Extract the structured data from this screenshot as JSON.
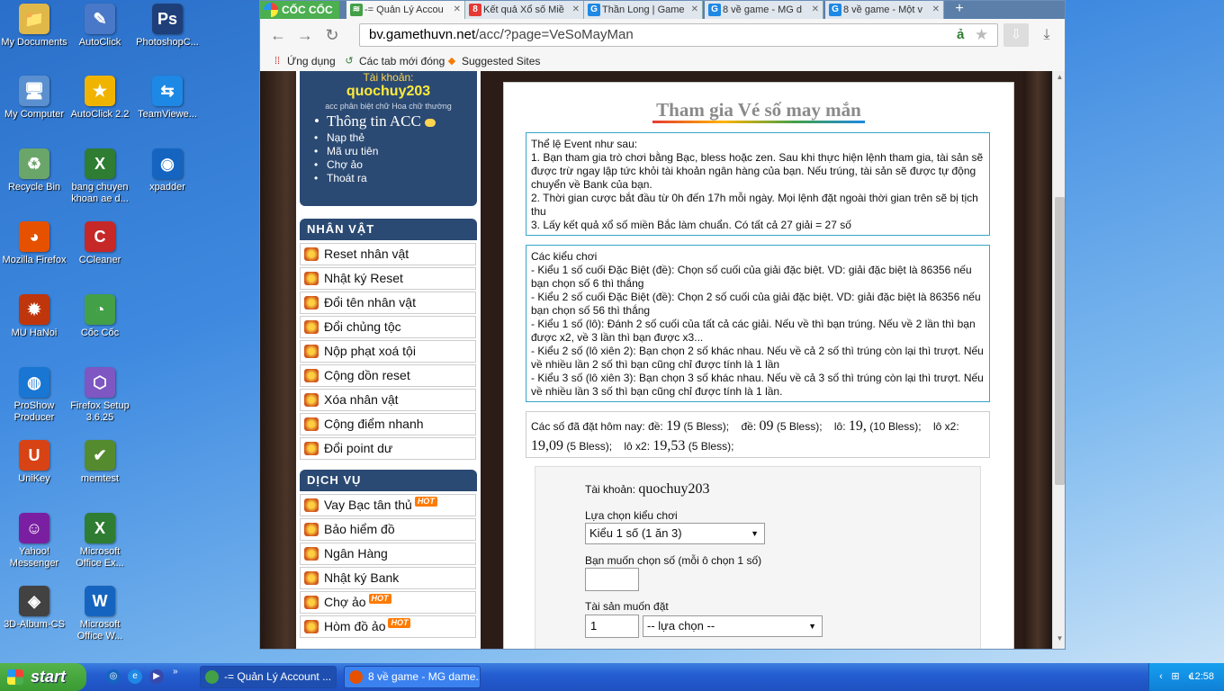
{
  "desktop": {
    "icons": [
      {
        "label": "My Documents",
        "icon": "folder-documents-icon",
        "color": "#e0b84a",
        "glyph": "📁"
      },
      {
        "label": "AutoClick",
        "icon": "autoclick-icon",
        "color": "#4a78c8",
        "glyph": "✎"
      },
      {
        "label": "PhotoshopC...",
        "icon": "photoshop-icon",
        "color": "#1f3f7a",
        "glyph": "Ps"
      },
      {
        "label": "My Computer",
        "icon": "computer-icon",
        "color": "#5a8fd0",
        "glyph": "🖥"
      },
      {
        "label": "AutoClick 2.2",
        "icon": "star-icon",
        "color": "#f0b400",
        "glyph": "★"
      },
      {
        "label": "TeamViewe...",
        "icon": "teamviewer-icon",
        "color": "#1e88e5",
        "glyph": "⇆"
      },
      {
        "label": "Recycle Bin",
        "icon": "recycle-bin-icon",
        "color": "#6aa56a",
        "glyph": "♻"
      },
      {
        "label": "bang chuyen khoan ae d...",
        "icon": "excel-file-icon",
        "color": "#2e7d32",
        "glyph": "X"
      },
      {
        "label": "xpadder",
        "icon": "xpadder-icon",
        "color": "#1565c0",
        "glyph": "◉"
      },
      {
        "label": "Mozilla Firefox",
        "icon": "firefox-icon",
        "color": "#e65100",
        "glyph": "◕"
      },
      {
        "label": "CCleaner",
        "icon": "ccleaner-icon",
        "color": "#c62828",
        "glyph": "C"
      },
      {
        "label": "MU HaNoi",
        "icon": "mu-game-icon",
        "color": "#bf360c",
        "glyph": "✹"
      },
      {
        "label": "Cốc Cốc",
        "icon": "coccoc-icon",
        "color": "#43a047",
        "glyph": "◔"
      },
      {
        "label": "ProShow Producer",
        "icon": "proshow-icon",
        "color": "#1976d2",
        "glyph": "◍"
      },
      {
        "label": "Firefox Setup 3.6.25",
        "icon": "installer-icon",
        "color": "#7e57c2",
        "glyph": "⬡"
      },
      {
        "label": "UniKey",
        "icon": "unikey-icon",
        "color": "#d84315",
        "glyph": "U"
      },
      {
        "label": "memtest",
        "icon": "memtest-icon",
        "color": "#558b2f",
        "glyph": "✔"
      },
      {
        "label": "Yahoo! Messenger",
        "icon": "yahoo-messenger-icon",
        "color": "#7b1fa2",
        "glyph": "☺"
      },
      {
        "label": "Microsoft Office Ex...",
        "icon": "excel-icon",
        "color": "#2e7d32",
        "glyph": "X"
      },
      {
        "label": "3D-Album-CS",
        "icon": "album-icon",
        "color": "#424242",
        "glyph": "◈"
      },
      {
        "label": "Microsoft Office W...",
        "icon": "word-icon",
        "color": "#1565c0",
        "glyph": "W"
      }
    ]
  },
  "browser": {
    "brand": "CỐC CỐC",
    "tabs": [
      {
        "label": "-= Quản Lý Accou",
        "fav": "≋",
        "favcolor": "#43a047"
      },
      {
        "label": "Kết quả Xổ số Miề",
        "fav": "8",
        "favcolor": "#e53935"
      },
      {
        "label": "Thần Long | Game",
        "fav": "G",
        "favcolor": "#1e88e5"
      },
      {
        "label": "8 về game - MG d",
        "fav": "G",
        "favcolor": "#1e88e5"
      },
      {
        "label": "8 về game - Một v",
        "fav": "G",
        "favcolor": "#1e88e5"
      }
    ],
    "url_host": "bv.gamethuvn.net",
    "url_path": "/acc/?page=VeSoMayMan",
    "bookmarks": [
      {
        "label": "Ứng dụng",
        "icon": "apps-grid-icon",
        "glyph": "⁞⁞"
      },
      {
        "label": "Các tab mới đóng",
        "icon": "recent-tabs-icon",
        "glyph": "↺"
      },
      {
        "label": "Suggested Sites",
        "icon": "suggested-sites-icon",
        "glyph": "◆"
      }
    ]
  },
  "sidebar": {
    "account_label": "Tài khoản:",
    "username": "quochuy203",
    "note": "acc phân biệt chữ Hoa chữ thường",
    "account_links": [
      "Thông tin ACC",
      "Nạp thẻ",
      "Mã ưu tiên",
      "Chợ ảo",
      "Thoát ra"
    ],
    "character_title": "NHÂN VẬT",
    "character_items": [
      "Reset nhân vật",
      "Nhật ký Reset",
      "Đổi tên nhân vật",
      "Đổi chủng tộc",
      "Nộp phạt xoá tội",
      "Cộng dồn reset",
      "Xóa nhân vật",
      "Cộng điểm nhanh",
      "Đổi point dư"
    ],
    "service_title": "DỊCH VỤ",
    "service_items": [
      {
        "label": "Vay Bạc tân thủ",
        "hot": true
      },
      {
        "label": "Bảo hiểm đồ",
        "hot": false
      },
      {
        "label": "Ngân Hàng",
        "hot": false
      },
      {
        "label": "Nhật ký Bank",
        "hot": false
      },
      {
        "label": "Chợ ảo",
        "hot": true
      },
      {
        "label": "Hòm đồ ảo",
        "hot": true
      }
    ],
    "hot_label": "HOT"
  },
  "main": {
    "title": "Tham gia Vé số may mắn",
    "rules": [
      "Thể lệ Event như sau:",
      "1. Bạn tham gia trò chơi bằng Bạc, bless hoặc zen. Sau khi thực hiện lệnh tham gia, tài sản sẽ được trừ ngay lập tức khỏi tài khoản ngân hàng của bạn. Nếu trúng, tài sản sẽ được tự động chuyển về Bank của bạn.",
      "2. Thời gian cược bắt đầu từ 0h đến 17h mỗi ngày. Mọi lệnh đặt ngoài thời gian trên sẽ bị tịch thu",
      "3. Lấy kết quả xổ số miền Bắc làm chuẩn. Có tất cả 27 giải = 27 số"
    ],
    "play_types": [
      "Các kiểu chơi",
      "- Kiểu 1 số cuối Đặc Biệt (đề): Chọn số cuối của giải đặc biệt. VD: giải đặc biệt là 86356 nếu bạn chọn số 6 thì thắng",
      "- Kiểu 2 số cuối Đặc Biệt (đề): Chọn 2 số cuối của giải đặc biệt. VD: giải đặc biệt là 86356 nếu bạn chọn số 56 thì thắng",
      "- Kiểu 1 số (lô): Đánh 2 số cuối của tất cả các giải. Nếu về thì bạn trúng. Nếu về 2 lần thì bạn được x2, về 3 lần thì bạn được x3...",
      "- Kiểu 2 số (lô xiên 2): Bạn chọn 2 số khác nhau. Nếu về cả 2 số thì trúng còn lại thì trượt. Nếu về nhiều lần 2 số thì bạn cũng chỉ được tính là 1 lần",
      "- Kiểu 3 số (lô xiên 3): Bạn chọn 3 số khác nhau. Nếu về cả 3 số thì trúng còn lại thì trượt. Nếu về nhiều lần 3 số thì bạn cũng chỉ được tính là 1 lần."
    ],
    "placed": {
      "intro": "Các số đã đặt hôm nay: đề:",
      "de1_num": "19",
      "de1_amt": "(5 Bless);",
      "de2_label": "đề:",
      "de2_num": "09",
      "de2_amt": "(5 Bless);",
      "lo_label": "lô:",
      "lo_num": "19,",
      "lo_amt": "(10 Bless);",
      "lox2a_label": "lô x2:",
      "lox2a_num": "19,09",
      "lox2a_amt": "(5 Bless);",
      "lox2b_label": "lô x2:",
      "lox2b_num": "19,53",
      "lox2b_amt": "(5 Bless);"
    },
    "form": {
      "account_label": "Tài khoản:",
      "account_value": "quochuy203",
      "type_label": "Lựa chọn kiểu chơi",
      "type_value": "Kiểu 1 số (1 ăn 3)",
      "number_label": "Bạn muốn chọn số (mỗi ô chọn 1 số)",
      "number_value": "",
      "asset_label": "Tài sản muốn đặt",
      "asset_qty": "1",
      "asset_select": "-- lựa chọn --"
    }
  },
  "taskbar": {
    "start_label": "start",
    "tasks": [
      {
        "label": "-= Quản Lý Account ...",
        "icon": "coccoc-task-icon",
        "color": "#43a047",
        "active": true
      },
      {
        "label": "8 về game - MG dame...",
        "icon": "firefox-task-icon",
        "color": "#e65100",
        "active": false
      }
    ],
    "clock": "12:58"
  }
}
